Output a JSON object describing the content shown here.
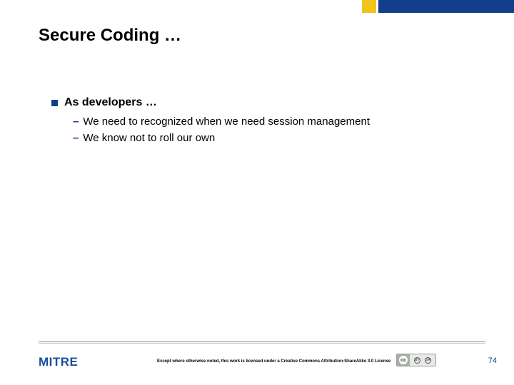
{
  "slide": {
    "title": "Secure Coding …",
    "main_bullet": "As developers …",
    "sub_bullets": [
      "We need to recognized when we need session management",
      "We know not to roll our own"
    ]
  },
  "footer": {
    "logo_text": "MITRE",
    "license": "Except where otherwise noted, this work is licensed under a Creative Commons Attribution-ShareAlike 3.0 License",
    "cc_label": "cc",
    "page_number": "74"
  },
  "colors": {
    "brand_blue": "#113f8c",
    "accent_yellow": "#f0c419"
  }
}
